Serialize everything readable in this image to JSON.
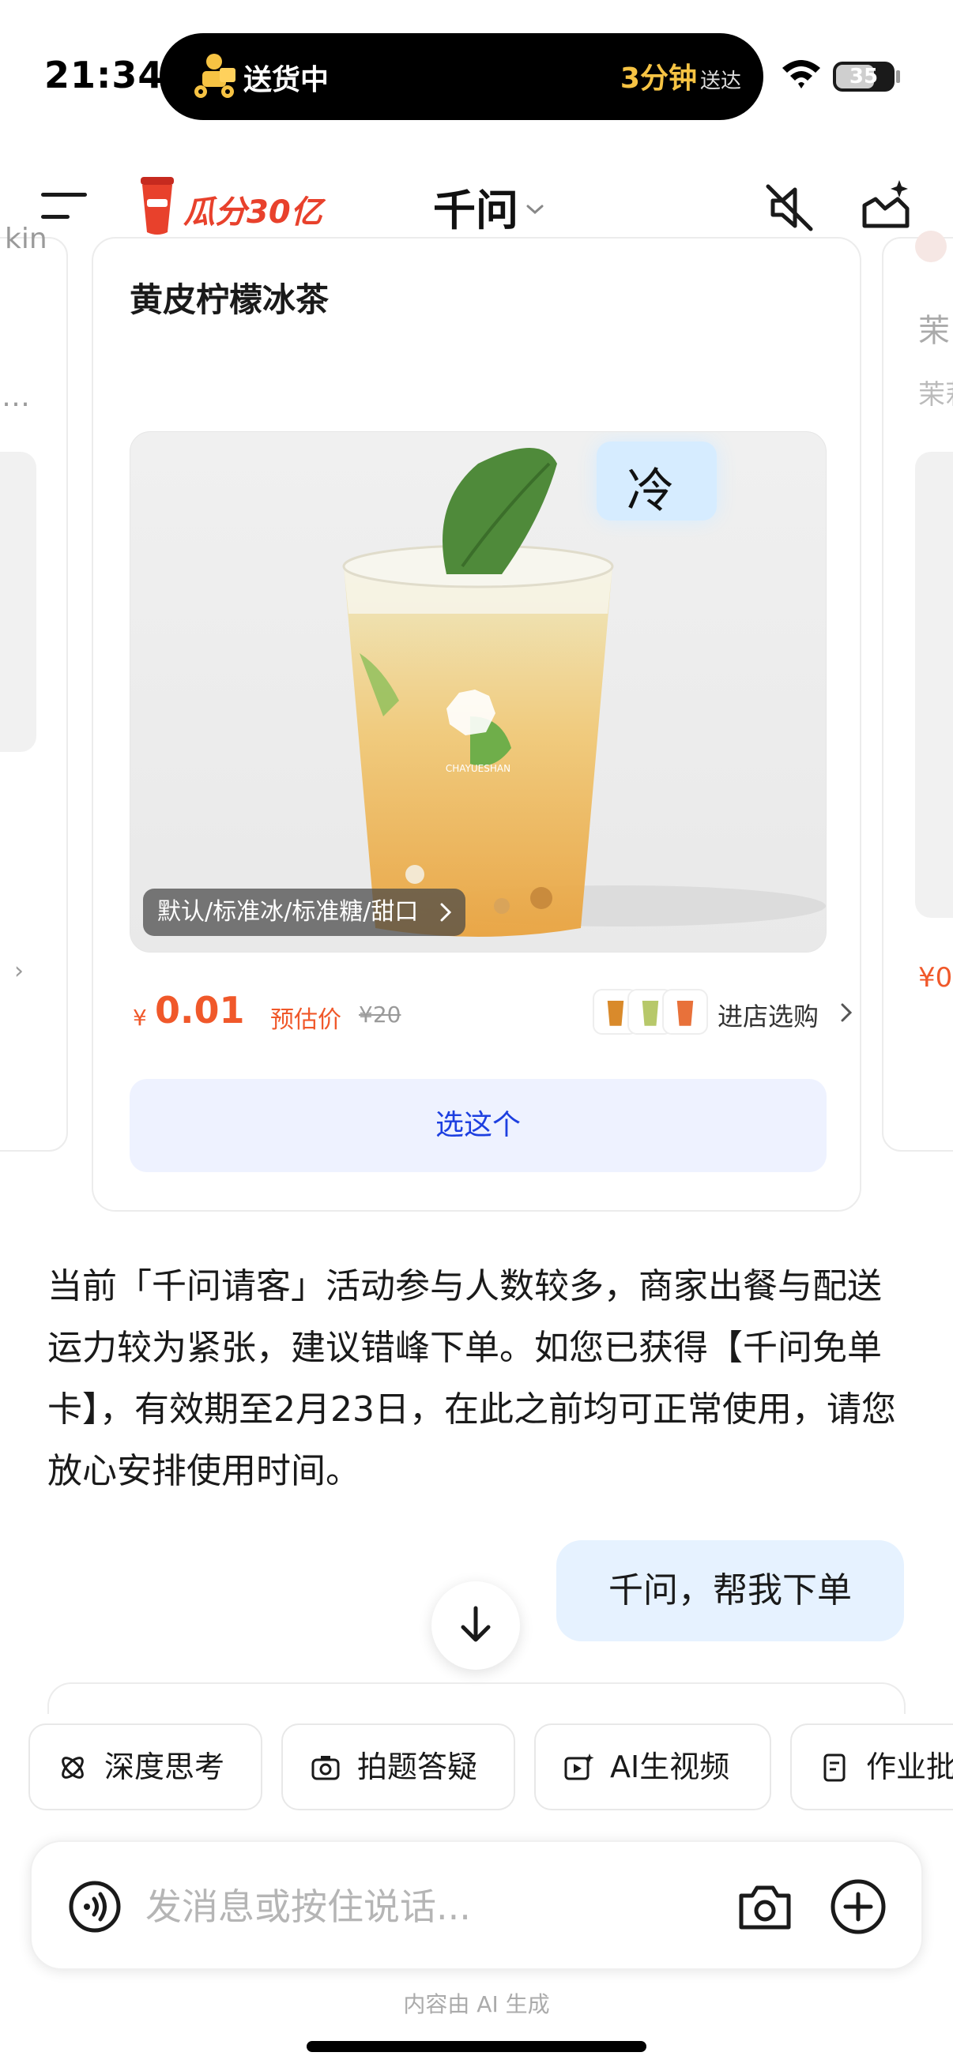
{
  "status_bar": {
    "time": "21:34",
    "island_status": "送货中",
    "island_eta": "3分钟",
    "island_eta_suffix": "送达",
    "battery": "35"
  },
  "header": {
    "promo_label": "瓜分30亿",
    "title": "千问",
    "icons": [
      "menu-icon",
      "promo-cup-icon",
      "chevron-down-icon",
      "mute-icon",
      "new-chat-icon"
    ]
  },
  "product_card": {
    "name": "黄皮柠檬冰茶",
    "badge": "冷",
    "spec": "默认/标准冰/标准糖/甜口",
    "price_currency": "¥",
    "price": "0.01",
    "price_tag": "预估价",
    "original_price": "¥20",
    "store_link": "进店选购",
    "choose_button": "选这个",
    "cup_logo_text": "CHAYUESHAN"
  },
  "side_cards": {
    "right_title": "茉",
    "right_subtitle": "茉莉",
    "right_price": "¥0"
  },
  "ai_message": "当前「千问请客」活动参与人数较多，商家出餐与配送运力较为紧张，建议错峰下单。如您已获得【千问免单卡】，有效期至2月23日，在此之前均可正常使用，请您放心安排使用时间。",
  "user_message": "千问，帮我下单",
  "quick_chips": [
    {
      "label": "深度思考",
      "icon": "deep-think-icon"
    },
    {
      "label": "拍题答疑",
      "icon": "camera-question-icon"
    },
    {
      "label": "AI生视频",
      "icon": "video-icon"
    },
    {
      "label": "作业批",
      "icon": "homework-icon"
    }
  ],
  "input": {
    "placeholder": "发消息或按住说话...",
    "value": ""
  },
  "disclaimer": "内容由 AI 生成",
  "colors": {
    "accent_blue": "#1d3fe0",
    "price_orange": "#f0582a",
    "bubble_blue": "#e6f2ff",
    "button_bg": "#eef2ff",
    "promo_red": "#e8412c"
  }
}
